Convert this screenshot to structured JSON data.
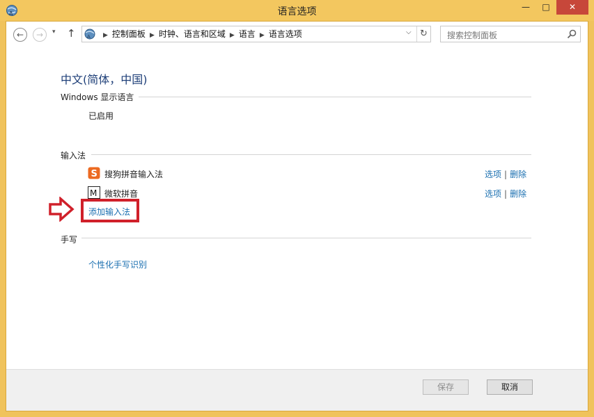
{
  "window": {
    "title": "语言选项",
    "controls": {
      "minimize": "—",
      "maximize": "□",
      "close": "✕"
    }
  },
  "nav": {
    "back_icon": "back-arrow-icon",
    "forward_icon": "forward-arrow-icon",
    "recent_icon": "chevron-down-icon",
    "up_icon": "up-arrow-icon",
    "back_glyph": "←",
    "forward_glyph": "→",
    "recent_glyph": "▾",
    "up_glyph": "↑"
  },
  "address": {
    "breadcrumbs": [
      "控制面板",
      "时钟、语言和区域",
      "语言",
      "语言选项"
    ],
    "separator": "▶",
    "dropdown_glyph": "⌵",
    "refresh_glyph": "↻"
  },
  "search": {
    "placeholder": "搜索控制面板"
  },
  "main": {
    "language_title": "中文(简体，中国)",
    "display_language": {
      "label": "Windows 显示语言",
      "status": "已启用"
    },
    "input_methods": {
      "label": "输入法",
      "items": [
        {
          "name": "搜狗拼音输入法",
          "icon": "sogou-icon",
          "icon_text": "S",
          "options": "选项",
          "remove": "删除"
        },
        {
          "name": "微软拼音",
          "icon": "microsoft-pinyin-icon",
          "icon_text": "M",
          "options": "选项",
          "remove": "删除"
        }
      ],
      "add_link": "添加输入法"
    },
    "handwriting": {
      "label": "手写",
      "link": "个性化手写识别"
    }
  },
  "footer": {
    "save": "保存",
    "cancel": "取消"
  },
  "colors": {
    "title_bar": "#f3c75f",
    "close_button": "#c7473a",
    "heading": "#1e3f78",
    "link": "#1a6fb0",
    "highlight_box": "#d0202a",
    "sogou_orange": "#ec6a21"
  }
}
